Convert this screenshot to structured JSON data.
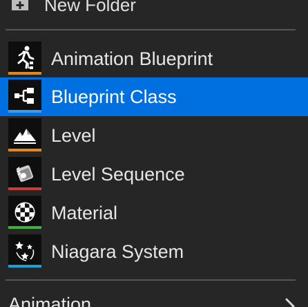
{
  "menu": {
    "new_folder": {
      "label": "New Folder",
      "icon": "folder-plus-icon"
    },
    "items": [
      {
        "label": "Animation Blueprint",
        "icon": "animation-blueprint-icon",
        "accent_color": "#e08a1e",
        "selected": false
      },
      {
        "label": "Blueprint Class",
        "icon": "blueprint-class-icon",
        "accent_color": "#3b9bf0",
        "selected": true
      },
      {
        "label": "Level",
        "icon": "level-icon",
        "accent_color": "#e08a1e",
        "selected": false
      },
      {
        "label": "Level Sequence",
        "icon": "level-sequence-icon",
        "accent_color": "#c83c3c",
        "selected": false
      },
      {
        "label": "Material",
        "icon": "material-icon",
        "accent_color": "#3cb43c",
        "selected": false
      },
      {
        "label": "Niagara System",
        "icon": "niagara-system-icon",
        "accent_color": "#1e9ed8",
        "selected": false
      }
    ],
    "submenu": {
      "label": "Animation",
      "icon": "chevron-right-icon"
    },
    "colors": {
      "background": "#262626",
      "selection": "#0070e0",
      "divider": "#555555"
    }
  }
}
